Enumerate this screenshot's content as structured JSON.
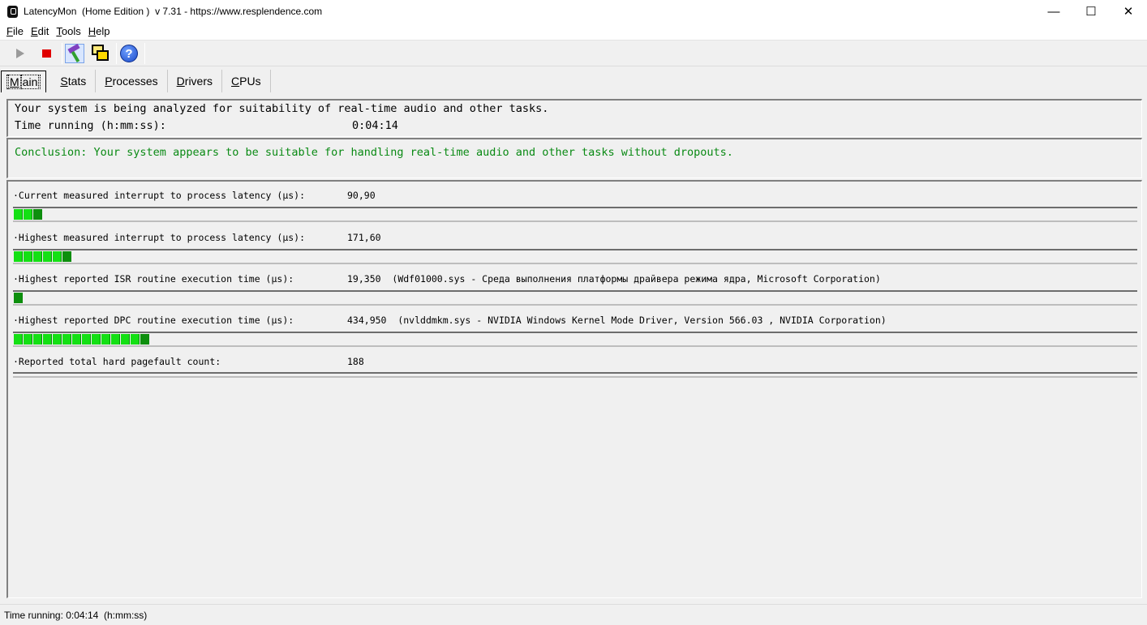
{
  "window": {
    "title": "LatencyMon  (Home Edition )  v 7.31 - https://www.resplendence.com",
    "minimize": "—",
    "maximize": "☐",
    "close": "✕"
  },
  "menu": {
    "items": [
      {
        "acc": "F",
        "rest": "ile"
      },
      {
        "acc": "E",
        "rest": "dit"
      },
      {
        "acc": "T",
        "rest": "ools"
      },
      {
        "acc": "H",
        "rest": "elp"
      }
    ]
  },
  "toolbar": {
    "icons": [
      "play-icon",
      "stop-icon",
      "tools-icon",
      "windows-icon",
      "help-icon"
    ],
    "help_glyph": "?"
  },
  "tabs": [
    {
      "acc": "M",
      "rest": "ain",
      "active": true
    },
    {
      "acc": "S",
      "rest": "tats",
      "active": false
    },
    {
      "acc": "P",
      "rest": "rocesses",
      "active": false
    },
    {
      "acc": "D",
      "rest": "rivers",
      "active": false
    },
    {
      "acc": "C",
      "rest": "PUs",
      "active": false
    }
  ],
  "status": {
    "analyzing_text": "Your system is being analyzed for suitability of real-time audio and other tasks.",
    "time_label": "Time running (h:mm:ss):",
    "time_value": "0:04:14",
    "conclusion": "Conclusion: Your system appears to be suitable for handling real-time audio and other tasks without dropouts.",
    "conclusion_color": "#0a8a14"
  },
  "metrics": [
    {
      "label": "·Current measured interrupt to process latency (µs):",
      "value": "90,90",
      "detail": "",
      "bar_segments": 3
    },
    {
      "label": "·Highest measured interrupt to process latency (µs):",
      "value": "171,60",
      "detail": "",
      "bar_segments": 6
    },
    {
      "label": "·Highest reported ISR routine execution time (µs):",
      "value": "19,350",
      "detail": "(Wdf01000.sys - Среда выполнения платформы драйвера режима ядра, Microsoft Corporation)",
      "bar_segments": 1
    },
    {
      "label": "·Highest reported DPC routine execution time (µs):",
      "value": "434,950",
      "detail": "(nvlddmkm.sys - NVIDIA Windows Kernel Mode Driver, Version 566.03 , NVIDIA Corporation)",
      "bar_segments": 14
    },
    {
      "label": "·Reported total hard pagefault count:",
      "value": "188",
      "detail": "",
      "bar_segments": 0
    }
  ],
  "statusbar": {
    "text": "Time running: 0:04:14  (h:mm:ss)"
  }
}
